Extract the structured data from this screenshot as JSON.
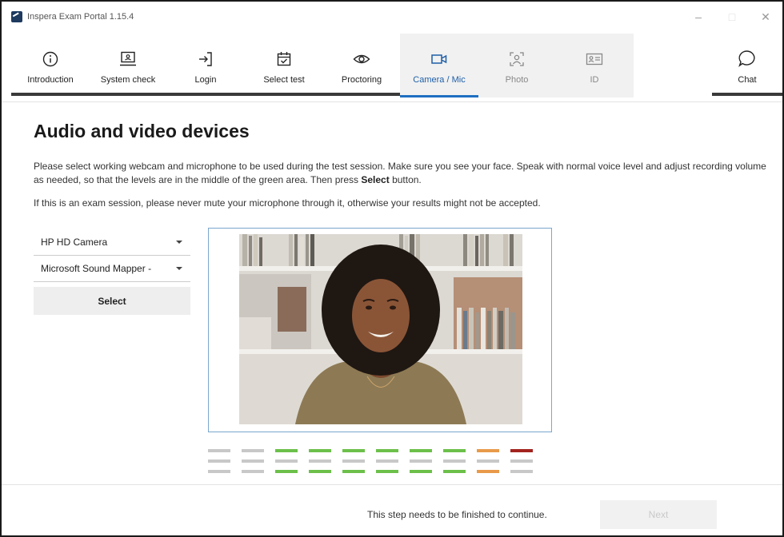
{
  "window": {
    "title": "Inspera Exam Portal 1.15.4",
    "controls": {
      "minimize": "–",
      "maximize": "□",
      "close": "✕"
    }
  },
  "steps": [
    {
      "label": "Introduction",
      "icon": "info-icon",
      "state": "done"
    },
    {
      "label": "System check",
      "icon": "laptop-icon",
      "state": "done"
    },
    {
      "label": "Login",
      "icon": "login-icon",
      "state": "done"
    },
    {
      "label": "Select test",
      "icon": "calendar-icon",
      "state": "done"
    },
    {
      "label": "Proctoring",
      "icon": "eye-icon",
      "state": "done"
    },
    {
      "label": "Camera / Mic",
      "icon": "camera-icon",
      "state": "active"
    },
    {
      "label": "Photo",
      "icon": "face-scan-icon",
      "state": "disabled"
    },
    {
      "label": "ID",
      "icon": "id-card-icon",
      "state": "disabled"
    }
  ],
  "chat": {
    "label": "Chat",
    "icon": "chat-bubble-icon"
  },
  "main": {
    "heading": "Audio and video devices",
    "instructions_before": "Please select working webcam and microphone to be used during the test session. Make sure you see your face. Speak with normal voice level and adjust recording volume as needed, so that the levels are in the middle of the green area. Then press ",
    "instructions_bold": "Select",
    "instructions_after": " button.",
    "warning": "If this is an exam session, please never mute your microphone through it, otherwise your results might not be accepted."
  },
  "devices": {
    "camera": "HP HD Camera",
    "microphone": "Microsoft Sound Mapper -",
    "select_label": "Select"
  },
  "volume_meter": {
    "columns": 10,
    "colors": [
      "#c8c8c8",
      "#c8c8c8",
      "#6cc04a",
      "#6cc04a",
      "#6cc04a",
      "#6cc04a",
      "#6cc04a",
      "#6cc04a",
      "#e89a4a",
      "#a3231f"
    ],
    "inactive_color": "#c8c8c8",
    "active_rows": [
      [
        0,
        2
      ],
      [
        0,
        2
      ],
      [
        0,
        2
      ],
      [
        0,
        2
      ],
      [
        0,
        2
      ],
      [
        0,
        2
      ],
      [
        0,
        2
      ],
      [
        0,
        2
      ],
      [
        0,
        2
      ],
      [
        0
      ]
    ]
  },
  "footer": {
    "message": "This step needs to be finished to continue.",
    "next_label": "Next"
  },
  "colors": {
    "accent": "#1f6fc1",
    "active_label": "#1f5fa8"
  }
}
